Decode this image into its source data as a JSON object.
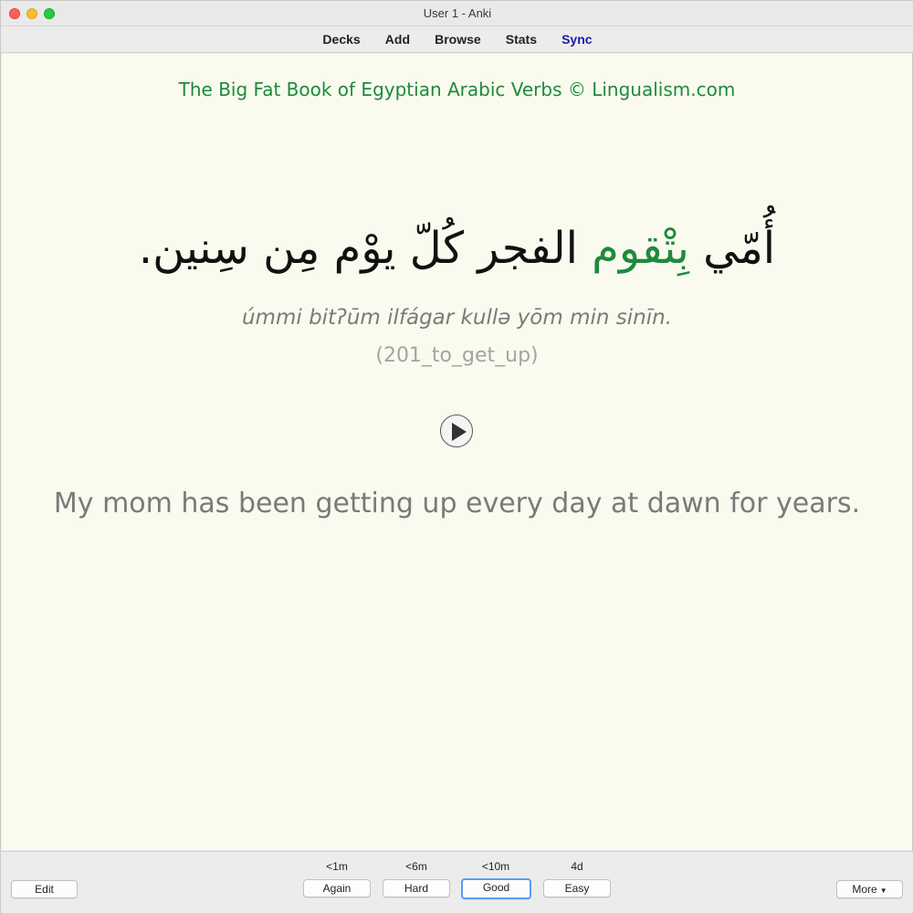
{
  "window": {
    "title": "User 1 - Anki"
  },
  "toolbar": {
    "items": [
      "Decks",
      "Add",
      "Browse",
      "Stats",
      "Sync"
    ]
  },
  "card": {
    "deck_title": "The Big Fat Book of Egyptian Arabic Verbs © Lingualism.com",
    "arabic_before": "أُمّي ",
    "arabic_highlight": "بِتْقوم",
    "arabic_after": " الفجر كُلّ يوْم مِن سِنين.",
    "transliteration": "úmmi bitʔūm ilfágar kullə yōm min sinīn.",
    "tag": "(201_to_get_up)",
    "english": "My mom has been getting up every day at dawn for years.",
    "highlight_color": "#1e8a3c"
  },
  "bottom": {
    "edit": "Edit",
    "more": "More",
    "answers": [
      {
        "interval": "<1m",
        "label": "Again"
      },
      {
        "interval": "<6m",
        "label": "Hard"
      },
      {
        "interval": "<10m",
        "label": "Good"
      },
      {
        "interval": "4d",
        "label": "Easy"
      }
    ]
  }
}
